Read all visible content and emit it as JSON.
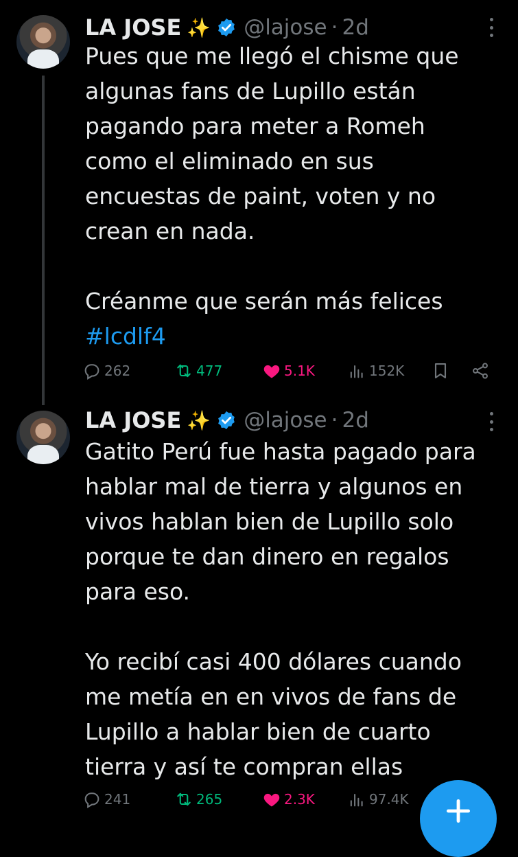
{
  "tweets": [
    {
      "display_name": "LA JOSE",
      "name_emoji": "✨",
      "handle": "@lajose",
      "separator": "·",
      "time": "2d",
      "body_lines": [
        "Pues que me llegó el chisme que",
        "algunas fans de Lupillo están",
        "pagando para meter a Romeh",
        "como el eliminado en sus",
        "encuestas de paint, voten y no",
        "crean en nada."
      ],
      "body_lines_2": [
        "Créanme que serán más felices"
      ],
      "hashtag": "#lcdlf4",
      "replies": "262",
      "retweets": "477",
      "likes": "5.1K",
      "views": "152K"
    },
    {
      "display_name": "LA JOSE",
      "name_emoji": "✨",
      "handle": "@lajose",
      "separator": "·",
      "time": "2d",
      "body_lines": [
        "Gatito Perú fue hasta pagado para",
        "hablar mal de tierra y algunos en",
        "vivos hablan bien de Lupillo solo",
        "porque te dan dinero en regalos",
        "para eso."
      ],
      "body_lines_2": [
        "Yo recibí casi 400 dólares cuando",
        "me metía en en vivos de fans de",
        "Lupillo a hablar bien de cuarto",
        "tierra y así te compran ellas"
      ],
      "replies": "241",
      "retweets": "265",
      "likes": "2.3K",
      "views": "97.4K"
    }
  ],
  "colors": {
    "background": "#000000",
    "text": "#e7e9ea",
    "muted": "#71767b",
    "accent": "#1d9bf0",
    "retweet": "#00ba7c",
    "like": "#f91880"
  },
  "icons": [
    "verified-badge-icon",
    "more-icon",
    "reply-icon",
    "retweet-icon",
    "like-icon",
    "views-icon",
    "bookmark-icon",
    "share-icon",
    "compose-icon"
  ]
}
